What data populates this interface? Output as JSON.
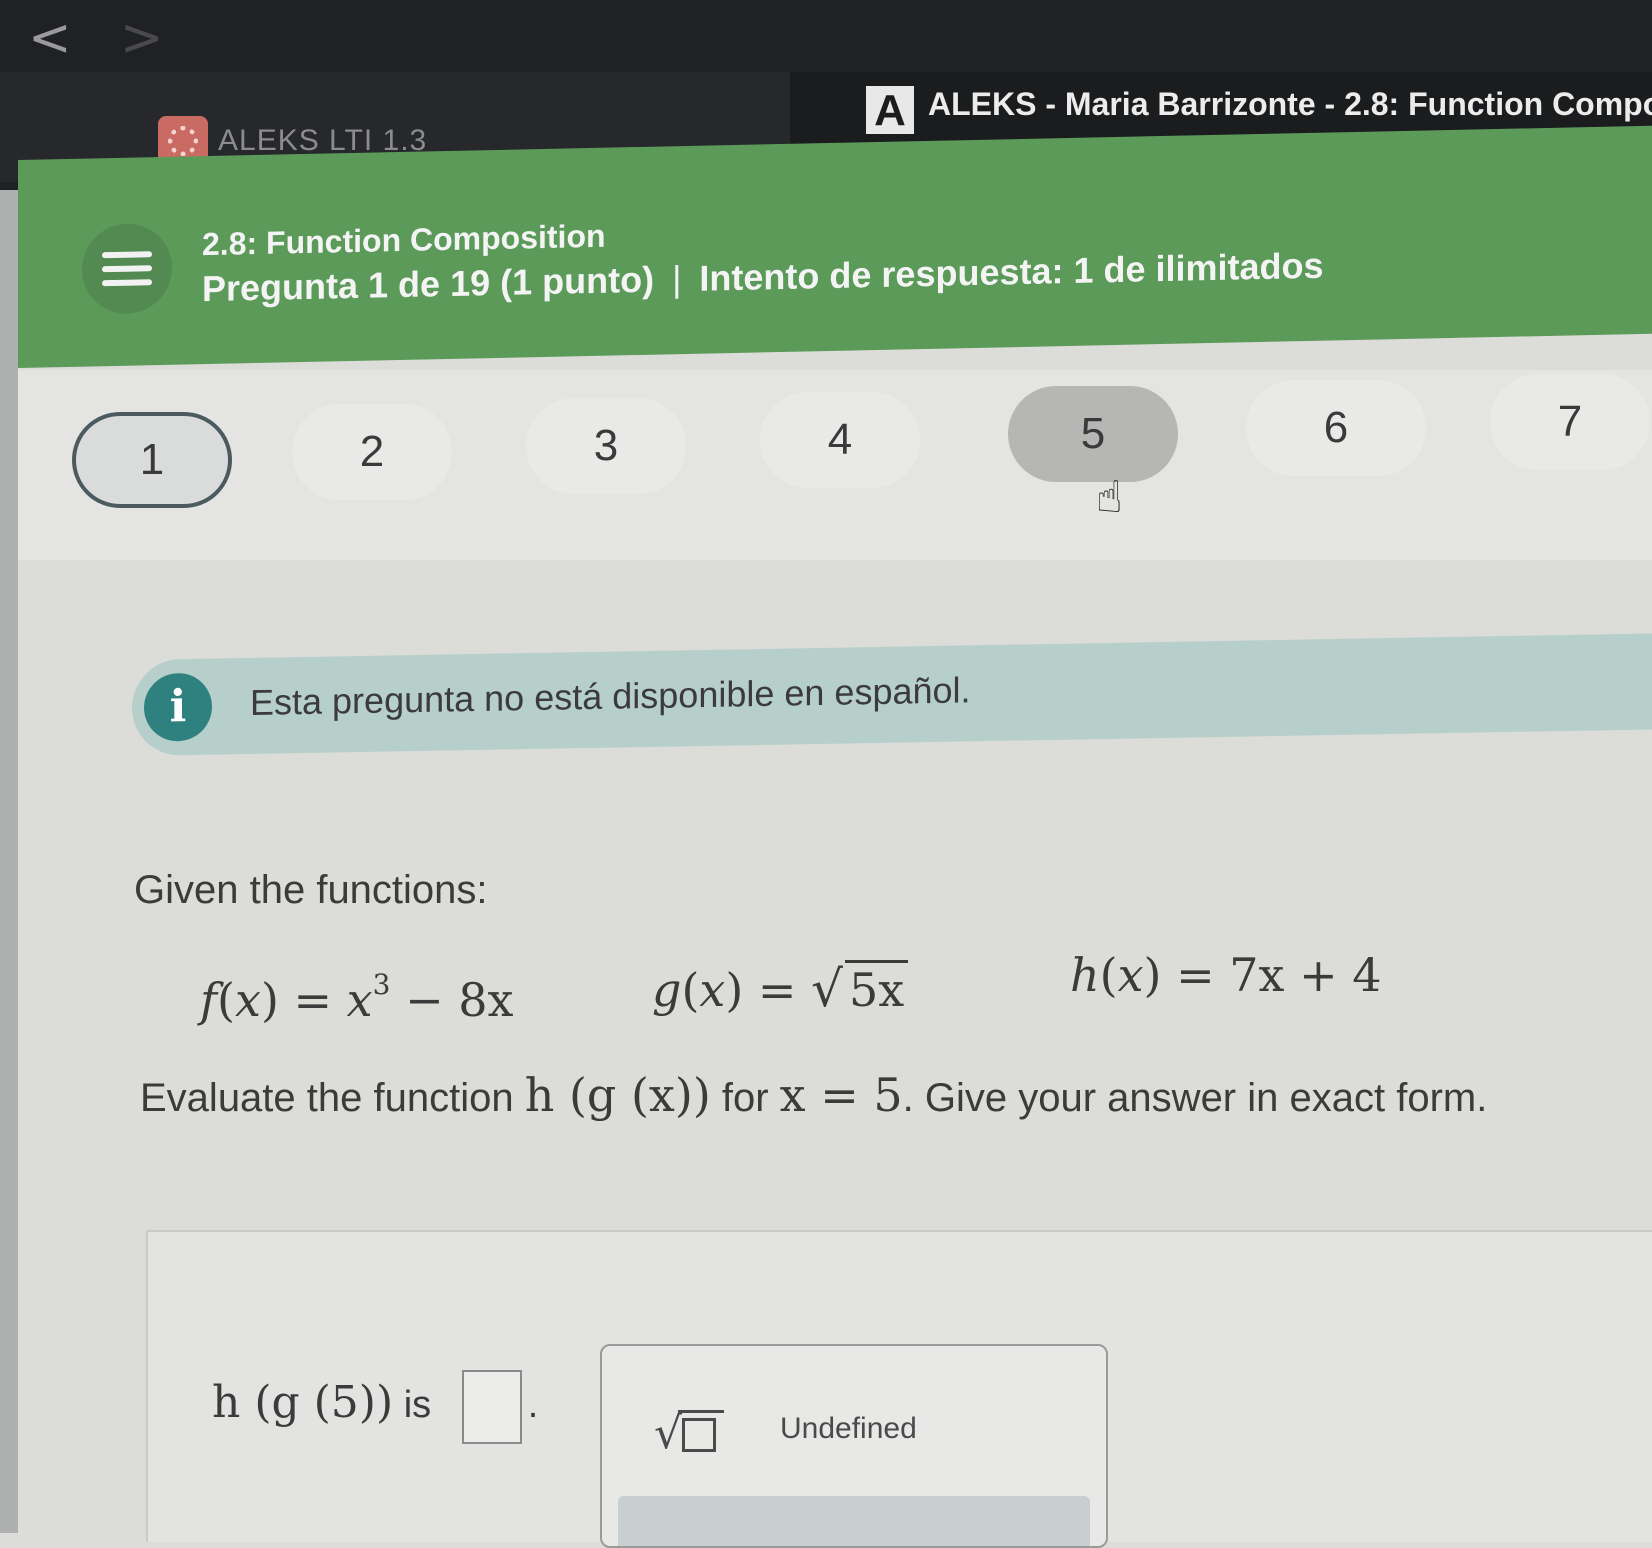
{
  "browser": {
    "back_glyph": "<",
    "forward_glyph": ">",
    "tabs": [
      {
        "label": "ALEKS LTI 1.3",
        "icon": "aleks-lti-icon"
      },
      {
        "label": "ALEKS - Maria Barrizonte - 2.8: Function Compo",
        "icon": "aleks-a-icon",
        "icon_text": "A"
      }
    ]
  },
  "header": {
    "title": "2.8: Function Composition",
    "question_info": "Pregunta 1 de 19 (1 punto)",
    "separator": "|",
    "attempt_info": "Intento de respuesta: 1 de ilimitados",
    "color": "#5c9a5a"
  },
  "question_nav": {
    "items": [
      "1",
      "2",
      "3",
      "4",
      "5",
      "6",
      "7"
    ],
    "current": "1",
    "hovered": "5"
  },
  "info": {
    "icon_text": "i",
    "message": "Esta pregunta no está disponible en español."
  },
  "problem": {
    "intro": "Given the functions:",
    "f": {
      "name": "f",
      "arg": "x",
      "body_base": "x",
      "body_exp": "3",
      "body_rest": " − 8x"
    },
    "g": {
      "name": "g",
      "arg": "x",
      "radicand": "5x"
    },
    "h": {
      "name": "h",
      "arg": "x",
      "body": "7x + 4"
    },
    "instruction_prefix": "Evaluate the function ",
    "instruction_expr": "h (g (x))",
    "instruction_mid": " for ",
    "instruction_cond": "x = 5",
    "instruction_suffix": ". Give your answer in exact form."
  },
  "answer": {
    "expr": "h (g (5))",
    "connector": " is ",
    "value": "",
    "period": "."
  },
  "tools": {
    "sqrt_button": "sqrt-icon",
    "undefined_label": "Undefined"
  }
}
